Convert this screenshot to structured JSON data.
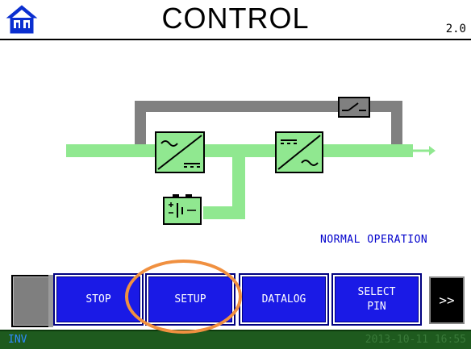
{
  "header": {
    "title": "CONTROL",
    "version": "2.0",
    "home_icon": "home-icon"
  },
  "diagram": {
    "status": "NORMAL OPERATION",
    "colors": {
      "flow": "#90e890",
      "bypass": "#808080",
      "status_text": "#0000cc"
    },
    "icons": [
      "rectifier-icon",
      "inverter-icon",
      "battery-icon",
      "bypass-switch-icon",
      "output-arrow-icon"
    ]
  },
  "buttons": {
    "stop": "STOP",
    "setup": "SETUP",
    "datalog": "DATALOG",
    "select_pin_line1": "SELECT",
    "select_pin_line2": "PIN",
    "more": ">>"
  },
  "statusbar": {
    "mode": "INV",
    "datetime": "2013-10-11 16:55"
  },
  "colors": {
    "button_blue": "#1a1ae6",
    "statusbar_green": "#1e5a1e",
    "annotation_orange": "#f09040"
  }
}
